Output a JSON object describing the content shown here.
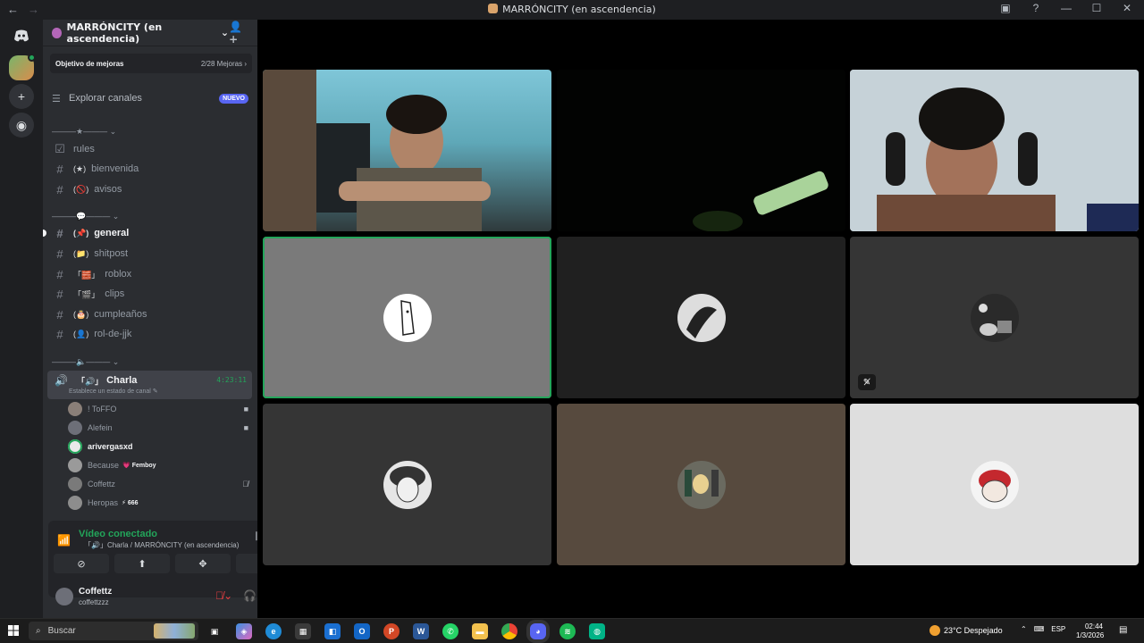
{
  "window": {
    "title": "MARRÓNCITY (en ascendencia)"
  },
  "server": {
    "name": "MARRÓNCITY (en ascendencia)",
    "boost_label": "Objetivo de mejoras",
    "boost_count": "2/28 Mejoras",
    "explore_label": "Explorar canales",
    "explore_badge": "NUEVO"
  },
  "categories": [
    {
      "label": "———★——— ⌄"
    },
    {
      "label": "———💬——— ⌄"
    },
    {
      "label": "———🔈——— ⌄"
    }
  ],
  "channels": [
    {
      "emoji": "",
      "name": "rules",
      "icon": "rules-icon"
    },
    {
      "emoji": "(★)",
      "name": "bienvenida"
    },
    {
      "emoji": "(🚫)",
      "name": "avisos"
    },
    {
      "emoji": "(📌)",
      "name": "general"
    },
    {
      "emoji": "(📁)",
      "name": "shitpost"
    },
    {
      "emoji": "「🧱」",
      "name": "roblox"
    },
    {
      "emoji": "「🎬」",
      "name": "clips"
    },
    {
      "emoji": "(🎂)",
      "name": "cumpleaños"
    },
    {
      "emoji": "(👤)",
      "name": "rol-de-jjk"
    }
  ],
  "voice_channel": {
    "emoji": "「🔊」",
    "name": "Charla",
    "timer": "4:23:11",
    "status_hint": "Establece un estado de canal"
  },
  "voice_users": [
    {
      "name": "! ToFFO",
      "right_icon": "camera-icon"
    },
    {
      "name": "Alefein",
      "right_icon": "camera-icon"
    },
    {
      "name": "arivergasxd",
      "right_icon": ""
    },
    {
      "name": "Because",
      "tag": "💗 Femboy",
      "right_icon": ""
    },
    {
      "name": "Coffettz",
      "right_icon": "muted-mic-icon"
    },
    {
      "name": "Heropas",
      "tag": "⚡ 666",
      "right_icon": ""
    }
  ],
  "voice_panel": {
    "title": "Vídeo conectado",
    "subtitle": "「🔊」Charla / MARRÓNCITY (en ascendencia)"
  },
  "user": {
    "name": "Coffettz",
    "handle": "coffettzzz"
  },
  "taskbar": {
    "search_placeholder": "Buscar",
    "weather": "23°C  Despejado",
    "lang": "ESP",
    "time": "02:44",
    "date": "1/3/2026"
  },
  "colors": {
    "accent_green": "#23a55a",
    "blurple": "#5865f2",
    "danger": "#f23f42"
  }
}
